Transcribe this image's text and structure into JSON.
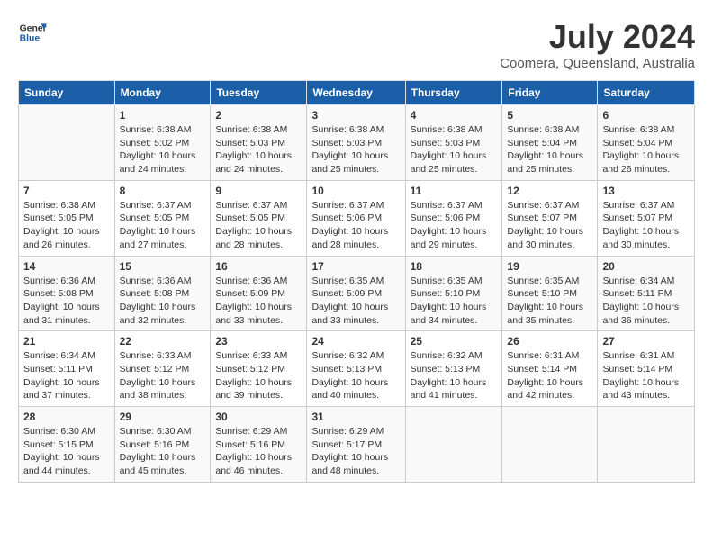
{
  "header": {
    "logo_line1": "General",
    "logo_line2": "Blue",
    "month": "July 2024",
    "location": "Coomera, Queensland, Australia"
  },
  "columns": [
    "Sunday",
    "Monday",
    "Tuesday",
    "Wednesday",
    "Thursday",
    "Friday",
    "Saturday"
  ],
  "weeks": [
    [
      {
        "day": "",
        "empty": true
      },
      {
        "day": "1",
        "sunrise": "6:38 AM",
        "sunset": "5:02 PM",
        "daylight": "10 hours and 24 minutes."
      },
      {
        "day": "2",
        "sunrise": "6:38 AM",
        "sunset": "5:03 PM",
        "daylight": "10 hours and 24 minutes."
      },
      {
        "day": "3",
        "sunrise": "6:38 AM",
        "sunset": "5:03 PM",
        "daylight": "10 hours and 25 minutes."
      },
      {
        "day": "4",
        "sunrise": "6:38 AM",
        "sunset": "5:03 PM",
        "daylight": "10 hours and 25 minutes."
      },
      {
        "day": "5",
        "sunrise": "6:38 AM",
        "sunset": "5:04 PM",
        "daylight": "10 hours and 25 minutes."
      },
      {
        "day": "6",
        "sunrise": "6:38 AM",
        "sunset": "5:04 PM",
        "daylight": "10 hours and 26 minutes."
      }
    ],
    [
      {
        "day": "7",
        "sunrise": "6:38 AM",
        "sunset": "5:05 PM",
        "daylight": "10 hours and 26 minutes."
      },
      {
        "day": "8",
        "sunrise": "6:37 AM",
        "sunset": "5:05 PM",
        "daylight": "10 hours and 27 minutes."
      },
      {
        "day": "9",
        "sunrise": "6:37 AM",
        "sunset": "5:05 PM",
        "daylight": "10 hours and 28 minutes."
      },
      {
        "day": "10",
        "sunrise": "6:37 AM",
        "sunset": "5:06 PM",
        "daylight": "10 hours and 28 minutes."
      },
      {
        "day": "11",
        "sunrise": "6:37 AM",
        "sunset": "5:06 PM",
        "daylight": "10 hours and 29 minutes."
      },
      {
        "day": "12",
        "sunrise": "6:37 AM",
        "sunset": "5:07 PM",
        "daylight": "10 hours and 30 minutes."
      },
      {
        "day": "13",
        "sunrise": "6:37 AM",
        "sunset": "5:07 PM",
        "daylight": "10 hours and 30 minutes."
      }
    ],
    [
      {
        "day": "14",
        "sunrise": "6:36 AM",
        "sunset": "5:08 PM",
        "daylight": "10 hours and 31 minutes."
      },
      {
        "day": "15",
        "sunrise": "6:36 AM",
        "sunset": "5:08 PM",
        "daylight": "10 hours and 32 minutes."
      },
      {
        "day": "16",
        "sunrise": "6:36 AM",
        "sunset": "5:09 PM",
        "daylight": "10 hours and 33 minutes."
      },
      {
        "day": "17",
        "sunrise": "6:35 AM",
        "sunset": "5:09 PM",
        "daylight": "10 hours and 33 minutes."
      },
      {
        "day": "18",
        "sunrise": "6:35 AM",
        "sunset": "5:10 PM",
        "daylight": "10 hours and 34 minutes."
      },
      {
        "day": "19",
        "sunrise": "6:35 AM",
        "sunset": "5:10 PM",
        "daylight": "10 hours and 35 minutes."
      },
      {
        "day": "20",
        "sunrise": "6:34 AM",
        "sunset": "5:11 PM",
        "daylight": "10 hours and 36 minutes."
      }
    ],
    [
      {
        "day": "21",
        "sunrise": "6:34 AM",
        "sunset": "5:11 PM",
        "daylight": "10 hours and 37 minutes."
      },
      {
        "day": "22",
        "sunrise": "6:33 AM",
        "sunset": "5:12 PM",
        "daylight": "10 hours and 38 minutes."
      },
      {
        "day": "23",
        "sunrise": "6:33 AM",
        "sunset": "5:12 PM",
        "daylight": "10 hours and 39 minutes."
      },
      {
        "day": "24",
        "sunrise": "6:32 AM",
        "sunset": "5:13 PM",
        "daylight": "10 hours and 40 minutes."
      },
      {
        "day": "25",
        "sunrise": "6:32 AM",
        "sunset": "5:13 PM",
        "daylight": "10 hours and 41 minutes."
      },
      {
        "day": "26",
        "sunrise": "6:31 AM",
        "sunset": "5:14 PM",
        "daylight": "10 hours and 42 minutes."
      },
      {
        "day": "27",
        "sunrise": "6:31 AM",
        "sunset": "5:14 PM",
        "daylight": "10 hours and 43 minutes."
      }
    ],
    [
      {
        "day": "28",
        "sunrise": "6:30 AM",
        "sunset": "5:15 PM",
        "daylight": "10 hours and 44 minutes."
      },
      {
        "day": "29",
        "sunrise": "6:30 AM",
        "sunset": "5:16 PM",
        "daylight": "10 hours and 45 minutes."
      },
      {
        "day": "30",
        "sunrise": "6:29 AM",
        "sunset": "5:16 PM",
        "daylight": "10 hours and 46 minutes."
      },
      {
        "day": "31",
        "sunrise": "6:29 AM",
        "sunset": "5:17 PM",
        "daylight": "10 hours and 48 minutes."
      },
      {
        "day": "",
        "empty": true
      },
      {
        "day": "",
        "empty": true
      },
      {
        "day": "",
        "empty": true
      }
    ]
  ]
}
